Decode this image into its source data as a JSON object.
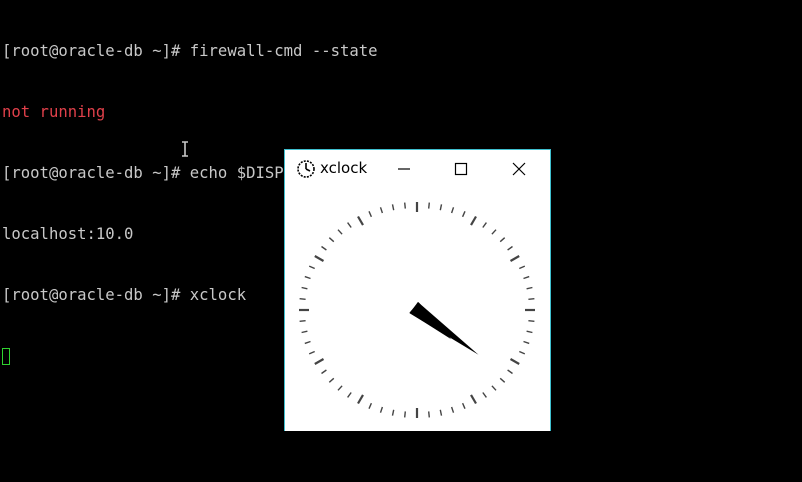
{
  "terminal": {
    "lines": [
      {
        "prompt": "[root@oracle-db ~]# ",
        "command": "firewall-cmd --state"
      },
      {
        "output": "not running",
        "kind": "error"
      },
      {
        "prompt": "[root@oracle-db ~]# ",
        "command": "echo $DISPLAY"
      },
      {
        "output": "localhost:10.0",
        "kind": "normal"
      },
      {
        "prompt": "[root@oracle-db ~]# ",
        "command": "xclock"
      }
    ],
    "colors": {
      "text": "#c8c8c8",
      "error": "#e0404a",
      "cursor": "#2fd22f",
      "background": "#000000"
    }
  },
  "xclock_window": {
    "title": "xclock",
    "icon": "clock-icon",
    "controls": [
      "minimize-icon",
      "maximize-icon",
      "close-icon"
    ],
    "time": {
      "hour": 4,
      "minute": 21
    }
  }
}
